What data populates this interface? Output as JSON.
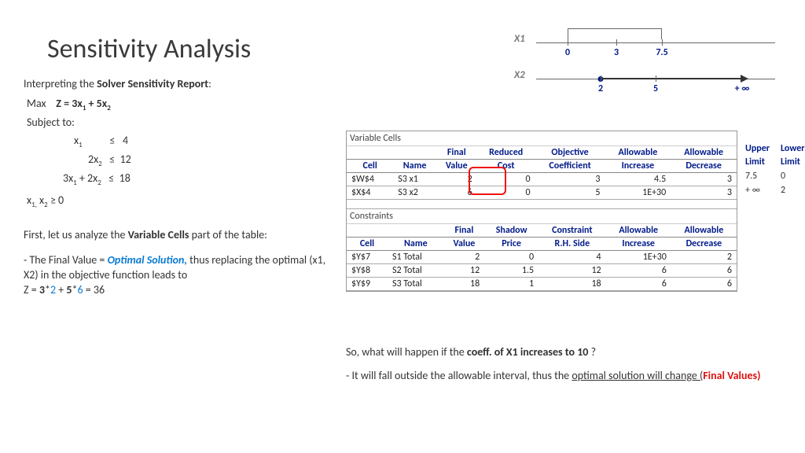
{
  "title": "Sensitivity Analysis",
  "interp_pre": "Interpreting the ",
  "interp_bold": "Solver Sensitivity Report",
  "interp_post": ":",
  "formula": {
    "max": "Max",
    "obj_pre": "Z = 3x",
    "obj_mid": " + 5x",
    "subject": "Subject to:",
    "c1_lhs": "x",
    "c1_op": "≤",
    "c1_rhs": "4",
    "c2_lhs_pre": "2x",
    "c2_op": "≤",
    "c2_rhs": "12",
    "c3_lhs_pre": "3x",
    "c3_lhs_mid": " + 2x",
    "c3_op": "≤",
    "c3_rhs": "18",
    "nonneg_pre": "x",
    "nonneg_mid": " x",
    "nonneg_op": "≥ 0"
  },
  "analysis1_pre": "First, let us analyze the ",
  "analysis1_bold": "Variable Cells",
  "analysis1_post": " part of the table:",
  "analysis2_p1": " - The Final Value = ",
  "analysis2_opt": "Optimal Solution,",
  "analysis2_p2": " thus replacing the optimal (x1, X2) in the objective function leads to",
  "analysis2_z": "Z = ",
  "analysis2_3": "3",
  "analysis2_star1": "*",
  "analysis2_2": "2",
  "analysis2_plus": " + ",
  "analysis2_5": "5",
  "analysis2_star2": "*",
  "analysis2_6": "6",
  "analysis2_eq": " = 36",
  "numline": {
    "x1_label": "X1",
    "x1_ticks": [
      "0",
      "3",
      "7.5"
    ],
    "x2_label": "X2",
    "x2_ticks": [
      "2",
      "5",
      "+ ∞"
    ]
  },
  "variable_section": "Variable Cells",
  "constraints_section": "Constraints",
  "var_headers": {
    "cell": "Cell",
    "name": "Name",
    "final": "Final",
    "final2": "Value",
    "reduced": "Reduced",
    "reduced2": "Cost",
    "obj": "Objective",
    "obj2": "Coefficient",
    "inc": "Allowable",
    "inc2": "Increase",
    "dec": "Allowable",
    "dec2": "Decrease"
  },
  "var_rows": [
    {
      "cell": "$W$4",
      "name": "S3 x1",
      "final": "2",
      "reduced": "0",
      "obj": "3",
      "inc": "4.5",
      "dec": "3"
    },
    {
      "cell": "$X$4",
      "name": "S3 x2",
      "final": "6",
      "reduced": "0",
      "obj": "5",
      "inc": "1E+30",
      "dec": "3"
    }
  ],
  "con_headers": {
    "cell": "Cell",
    "name": "Name",
    "final": "Final",
    "final2": "Value",
    "shadow": "Shadow",
    "shadow2": "Price",
    "rhs": "Constraint",
    "rhs2": "R.H. Side",
    "inc": "Allowable",
    "inc2": "Increase",
    "dec": "Allowable",
    "dec2": "Decrease"
  },
  "con_rows": [
    {
      "cell": "$Y$7",
      "name": "S1 Total",
      "final": "2",
      "shadow": "0",
      "rhs": "4",
      "inc": "1E+30",
      "dec": "2"
    },
    {
      "cell": "$Y$8",
      "name": "S2 Total",
      "final": "12",
      "shadow": "1.5",
      "rhs": "12",
      "inc": "6",
      "dec": "6"
    },
    {
      "cell": "$Y$9",
      "name": "S3 Total",
      "final": "18",
      "shadow": "1",
      "rhs": "18",
      "inc": "6",
      "dec": "6"
    }
  ],
  "extra": {
    "h1a": "Upper",
    "h1b": "Limit",
    "h2a": "Lower",
    "h2b": "Limit",
    "r1a": "7.5",
    "r1b": "0",
    "r2a": "+ ∞",
    "r2b": "2"
  },
  "q_pre": "So, what will happen if the ",
  "q_bold": "coeff. of X1 increases to 10",
  "q_post": " ?",
  "a_pre": " - It will fall outside the allowable interval, thus the ",
  "a_under": "optimal solution will change ",
  "a_open": "(",
  "a_red": "Final Values)"
}
